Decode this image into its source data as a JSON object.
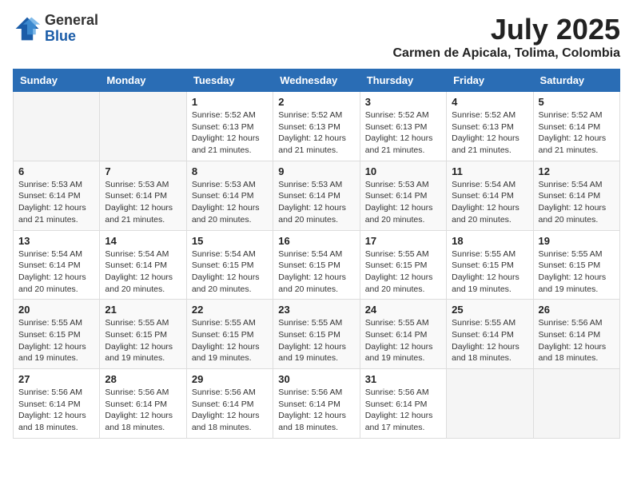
{
  "header": {
    "logo_general": "General",
    "logo_blue": "Blue",
    "month_title": "July 2025",
    "location": "Carmen de Apicala, Tolima, Colombia"
  },
  "weekdays": [
    "Sunday",
    "Monday",
    "Tuesday",
    "Wednesday",
    "Thursday",
    "Friday",
    "Saturday"
  ],
  "weeks": [
    [
      {
        "day": "",
        "info": ""
      },
      {
        "day": "",
        "info": ""
      },
      {
        "day": "1",
        "info": "Sunrise: 5:52 AM\nSunset: 6:13 PM\nDaylight: 12 hours and 21 minutes."
      },
      {
        "day": "2",
        "info": "Sunrise: 5:52 AM\nSunset: 6:13 PM\nDaylight: 12 hours and 21 minutes."
      },
      {
        "day": "3",
        "info": "Sunrise: 5:52 AM\nSunset: 6:13 PM\nDaylight: 12 hours and 21 minutes."
      },
      {
        "day": "4",
        "info": "Sunrise: 5:52 AM\nSunset: 6:13 PM\nDaylight: 12 hours and 21 minutes."
      },
      {
        "day": "5",
        "info": "Sunrise: 5:52 AM\nSunset: 6:14 PM\nDaylight: 12 hours and 21 minutes."
      }
    ],
    [
      {
        "day": "6",
        "info": "Sunrise: 5:53 AM\nSunset: 6:14 PM\nDaylight: 12 hours and 21 minutes."
      },
      {
        "day": "7",
        "info": "Sunrise: 5:53 AM\nSunset: 6:14 PM\nDaylight: 12 hours and 21 minutes."
      },
      {
        "day": "8",
        "info": "Sunrise: 5:53 AM\nSunset: 6:14 PM\nDaylight: 12 hours and 20 minutes."
      },
      {
        "day": "9",
        "info": "Sunrise: 5:53 AM\nSunset: 6:14 PM\nDaylight: 12 hours and 20 minutes."
      },
      {
        "day": "10",
        "info": "Sunrise: 5:53 AM\nSunset: 6:14 PM\nDaylight: 12 hours and 20 minutes."
      },
      {
        "day": "11",
        "info": "Sunrise: 5:54 AM\nSunset: 6:14 PM\nDaylight: 12 hours and 20 minutes."
      },
      {
        "day": "12",
        "info": "Sunrise: 5:54 AM\nSunset: 6:14 PM\nDaylight: 12 hours and 20 minutes."
      }
    ],
    [
      {
        "day": "13",
        "info": "Sunrise: 5:54 AM\nSunset: 6:14 PM\nDaylight: 12 hours and 20 minutes."
      },
      {
        "day": "14",
        "info": "Sunrise: 5:54 AM\nSunset: 6:14 PM\nDaylight: 12 hours and 20 minutes."
      },
      {
        "day": "15",
        "info": "Sunrise: 5:54 AM\nSunset: 6:15 PM\nDaylight: 12 hours and 20 minutes."
      },
      {
        "day": "16",
        "info": "Sunrise: 5:54 AM\nSunset: 6:15 PM\nDaylight: 12 hours and 20 minutes."
      },
      {
        "day": "17",
        "info": "Sunrise: 5:55 AM\nSunset: 6:15 PM\nDaylight: 12 hours and 20 minutes."
      },
      {
        "day": "18",
        "info": "Sunrise: 5:55 AM\nSunset: 6:15 PM\nDaylight: 12 hours and 19 minutes."
      },
      {
        "day": "19",
        "info": "Sunrise: 5:55 AM\nSunset: 6:15 PM\nDaylight: 12 hours and 19 minutes."
      }
    ],
    [
      {
        "day": "20",
        "info": "Sunrise: 5:55 AM\nSunset: 6:15 PM\nDaylight: 12 hours and 19 minutes."
      },
      {
        "day": "21",
        "info": "Sunrise: 5:55 AM\nSunset: 6:15 PM\nDaylight: 12 hours and 19 minutes."
      },
      {
        "day": "22",
        "info": "Sunrise: 5:55 AM\nSunset: 6:15 PM\nDaylight: 12 hours and 19 minutes."
      },
      {
        "day": "23",
        "info": "Sunrise: 5:55 AM\nSunset: 6:15 PM\nDaylight: 12 hours and 19 minutes."
      },
      {
        "day": "24",
        "info": "Sunrise: 5:55 AM\nSunset: 6:14 PM\nDaylight: 12 hours and 19 minutes."
      },
      {
        "day": "25",
        "info": "Sunrise: 5:55 AM\nSunset: 6:14 PM\nDaylight: 12 hours and 18 minutes."
      },
      {
        "day": "26",
        "info": "Sunrise: 5:56 AM\nSunset: 6:14 PM\nDaylight: 12 hours and 18 minutes."
      }
    ],
    [
      {
        "day": "27",
        "info": "Sunrise: 5:56 AM\nSunset: 6:14 PM\nDaylight: 12 hours and 18 minutes."
      },
      {
        "day": "28",
        "info": "Sunrise: 5:56 AM\nSunset: 6:14 PM\nDaylight: 12 hours and 18 minutes."
      },
      {
        "day": "29",
        "info": "Sunrise: 5:56 AM\nSunset: 6:14 PM\nDaylight: 12 hours and 18 minutes."
      },
      {
        "day": "30",
        "info": "Sunrise: 5:56 AM\nSunset: 6:14 PM\nDaylight: 12 hours and 18 minutes."
      },
      {
        "day": "31",
        "info": "Sunrise: 5:56 AM\nSunset: 6:14 PM\nDaylight: 12 hours and 17 minutes."
      },
      {
        "day": "",
        "info": ""
      },
      {
        "day": "",
        "info": ""
      }
    ]
  ]
}
